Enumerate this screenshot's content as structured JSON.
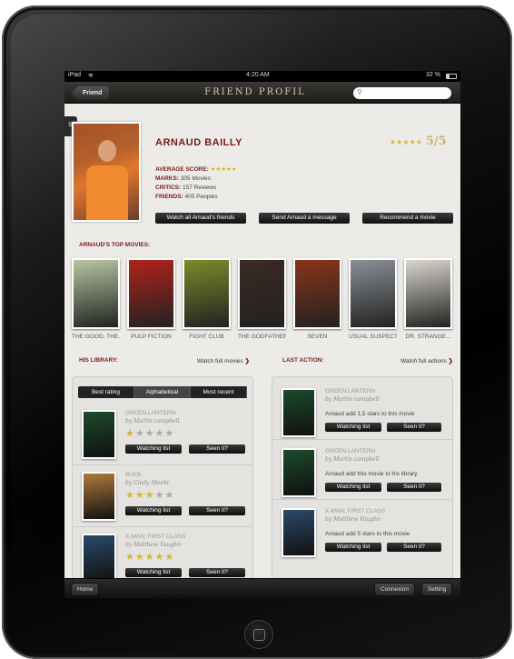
{
  "status": {
    "device": "iPad",
    "time": "4:20 AM",
    "battery": "32 %"
  },
  "nav": {
    "back": "Friend",
    "title": "FRIEND PROFIL",
    "search_placeholder": ""
  },
  "profile": {
    "name": "ARNAUD BAILLY",
    "rating_stars": "★★★★★",
    "rating_value": "5/5",
    "average_label": "AVERAGE SCORE:",
    "average_stars": "★★★★★",
    "marks_label": "MARKS:",
    "marks_value": "305 Movies",
    "critics_label": "CRITICS:",
    "critics_value": "157 Reviews",
    "friends_label": "FRIENDS:",
    "friends_value": "405 Peoples",
    "buttons": [
      "Watch all Arnaud's friends",
      "Send Arnaud a message",
      "Recommend a movie"
    ]
  },
  "top_movies": {
    "title": "ARNAUD'S TOP MOVIES:",
    "items": [
      {
        "label": "THE GOOD, THE...",
        "color": "#b6c7a0"
      },
      {
        "label": "PULP FICTION",
        "color": "#b1221a"
      },
      {
        "label": "FIGHT CLUB",
        "color": "#7d8a2a"
      },
      {
        "label": "THE GODFATHER",
        "color": "#3a2a22"
      },
      {
        "label": "SEVEN",
        "color": "#8a3418"
      },
      {
        "label": "USUAL SUSPECT",
        "color": "#8a8f96"
      },
      {
        "label": "DR. STRANGE...",
        "color": "#d9d6cc"
      }
    ]
  },
  "library": {
    "title": "HIS LIBRARY:",
    "link": "Watch full movies",
    "tabs": [
      "Best rating",
      "Alphabetical",
      "Most recent"
    ],
    "items": [
      {
        "title": "GREEN LANTERN",
        "author": "by Martin campbell",
        "stars": "★★★★★",
        "filled": 1,
        "color": "#1c4a2a"
      },
      {
        "title": "BUCK",
        "author": "by Cindy Meehl",
        "stars": "★★★★★",
        "filled": 3,
        "color": "#b07a3a"
      },
      {
        "title": "X-MAN; FIRST CLASS",
        "author": "by Matthew Vaughn",
        "stars": "★★★★★",
        "filled": 5,
        "color": "#2a4a6a"
      }
    ],
    "btn_watch": "Watching list",
    "btn_seen": "Seen it?"
  },
  "actions": {
    "title": "LAST ACTION:",
    "link": "Watch full actions",
    "items": [
      {
        "title": "GREEN LANTERN",
        "author": "by Martin campbell",
        "text": "Arnaud add 1,5 stars to this movie",
        "color": "#1c4a2a"
      },
      {
        "title": "GREEN LANTERN",
        "author": "by Martin campbell",
        "text": "Arnaud add this movie to his library",
        "color": "#1c4a2a"
      },
      {
        "title": "X-MAN; FIRST CLASS",
        "author": "by Matthew Vaughn",
        "text": "Arnaud add 5 stars to this movie",
        "color": "#2a4a6a"
      }
    ]
  },
  "tabbar": {
    "home": "Home",
    "connexion": "Connexion",
    "setting": "Setting"
  }
}
